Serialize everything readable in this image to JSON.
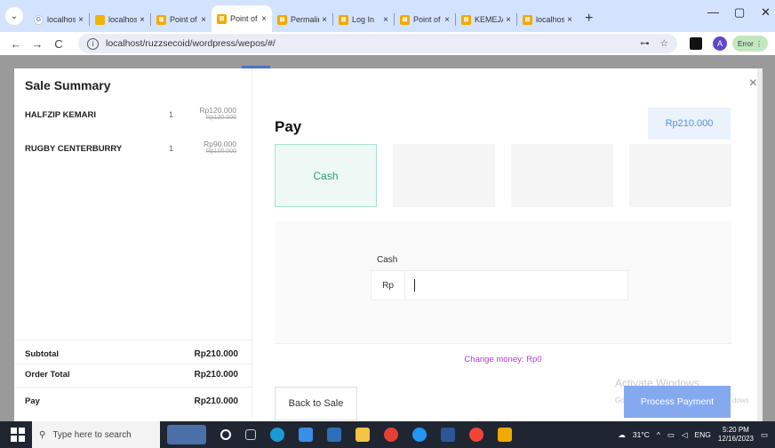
{
  "browser": {
    "tabs": [
      {
        "title": "localhost",
        "favicon": "google-icon"
      },
      {
        "title": "localhost",
        "favicon": "woocommerce-icon"
      },
      {
        "title": "Point of",
        "favicon": "pos-icon"
      },
      {
        "title": "Point of",
        "favicon": "pos-icon",
        "active": true
      },
      {
        "title": "Permalink",
        "favicon": "pos-icon"
      },
      {
        "title": "Log In",
        "favicon": "pos-icon"
      },
      {
        "title": "Point of",
        "favicon": "pos-icon"
      },
      {
        "title": "KEMEJA",
        "favicon": "pos-icon"
      },
      {
        "title": "localhost",
        "favicon": "pos-icon"
      }
    ],
    "url": "localhost/ruzzsecoid/wordpress/wepos/#/",
    "profile_initial": "A",
    "error_label": "Error"
  },
  "summary": {
    "title": "Sale Summary",
    "items": [
      {
        "name": "HALFZIP KEMARI",
        "qty": "1",
        "price": "Rp120.000",
        "old_price": "Rp130.000"
      },
      {
        "name": "RUGBY CENTERBURRY",
        "qty": "1",
        "price": "Rp90.000",
        "old_price": "Rp100.000"
      }
    ],
    "subtotal_label": "Subtotal",
    "subtotal_value": "Rp210.000",
    "order_total_label": "Order Total",
    "order_total_value": "Rp210.000",
    "pay_label": "Pay",
    "pay_value": "Rp210.000"
  },
  "payment": {
    "title": "Pay",
    "total": "Rp210.000",
    "methods": [
      "Cash",
      "",
      "",
      ""
    ],
    "cash_label": "Cash",
    "currency_prefix": "Rp",
    "cash_value": "",
    "change_text": "Change money: Rp0",
    "back_label": "Back to Sale",
    "process_label": "Process Payment",
    "watermark_line1": "Activate Windows",
    "watermark_line2": "Go",
    "watermark_line3": "dows."
  },
  "taskbar": {
    "search_placeholder": "Type here to search",
    "temperature": "31°C",
    "language": "ENG",
    "time": "5:20 PM",
    "date": "12/16/2023"
  }
}
